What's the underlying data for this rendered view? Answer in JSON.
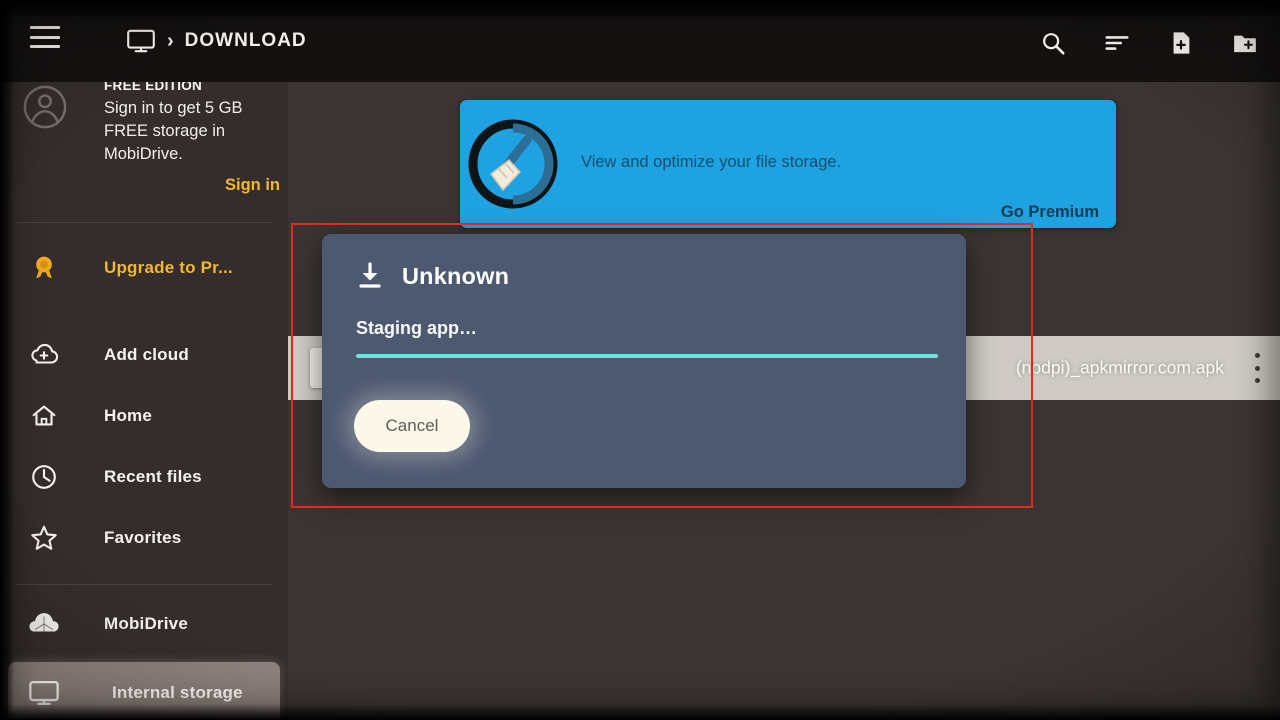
{
  "appbar": {
    "menu_icon": "hamburger-icon",
    "breadcrumb": {
      "root_icon": "internal-storage-monitor-icon",
      "separator": "›",
      "current": "DOWNLOAD"
    },
    "actions": [
      {
        "name": "search-icon",
        "label": "Search"
      },
      {
        "name": "sort-icon",
        "label": "Sort"
      },
      {
        "name": "new-file-icon",
        "label": "New file"
      },
      {
        "name": "new-folder-icon",
        "label": "New folder"
      }
    ]
  },
  "sidebar": {
    "account": {
      "avatar_icon": "account-avatar-icon",
      "edition": "FREE EDITION",
      "description": "Sign in to get 5 GB FREE storage in MobiDrive.",
      "sign_in_label": "Sign in",
      "sign_in_color": "#f3b72c"
    },
    "items": [
      {
        "label": "Upgrade to Pr...",
        "icon": "award-ribbon-icon",
        "style": "gold",
        "selected": false
      },
      {
        "label": "Add cloud",
        "icon": "cloud-plus-icon",
        "style": "normal",
        "selected": false
      },
      {
        "label": "Home",
        "icon": "home-icon",
        "style": "normal",
        "selected": false
      },
      {
        "label": "Recent files",
        "icon": "clock-icon",
        "style": "normal",
        "selected": false
      },
      {
        "label": "Favorites",
        "icon": "star-icon",
        "style": "normal",
        "selected": false
      },
      {
        "label": "MobiDrive",
        "icon": "mobidrive-cloud-icon",
        "style": "normal",
        "selected": false
      },
      {
        "label": "Internal storage",
        "icon": "monitor-icon",
        "style": "normal",
        "selected": true
      }
    ]
  },
  "main": {
    "promo": {
      "icon": "broom-clean-icon",
      "text": "View and optimize your file storage.",
      "cta": "Go Premium",
      "background": "#1ea2e2",
      "text_color": "#13506d"
    },
    "file_row": {
      "thumb_icon": "file-thumbnail-icon",
      "name": "(nodpi)_apkmirror.com.apk",
      "overflow_icon": "more-vertical-icon",
      "background": "#cfcbc4"
    }
  },
  "dialog": {
    "icon": "download-icon",
    "title": "Unknown",
    "status": "Staging app…",
    "progress_percent": 100,
    "progress_color": "#6fe4dc",
    "background": "#4d5871",
    "cancel_label": "Cancel"
  },
  "annotation": {
    "shape": "rectangle",
    "color": "#e02b22"
  }
}
